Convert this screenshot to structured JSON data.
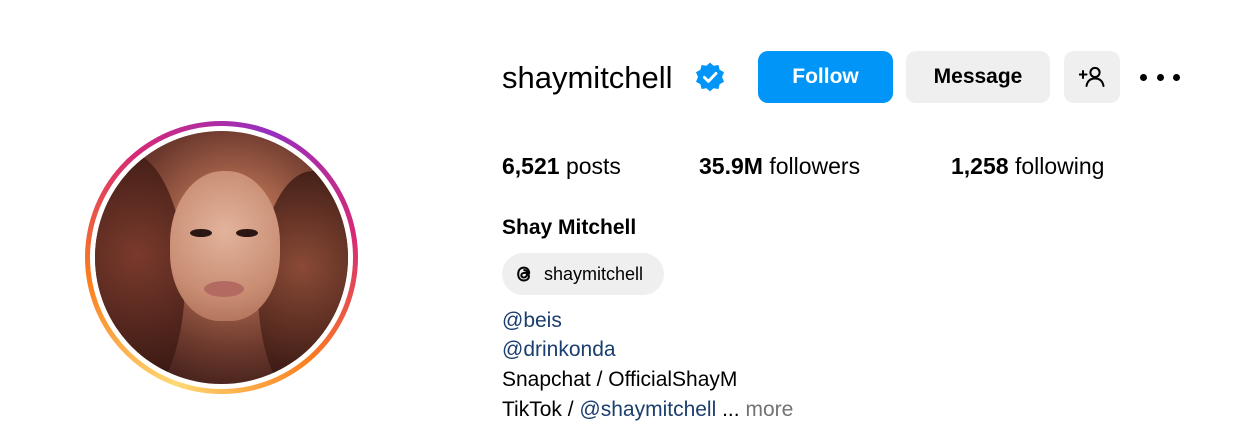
{
  "profile": {
    "username": "shaymitchell",
    "verified": true,
    "full_name": "Shay Mitchell",
    "avatar": "profile-photo"
  },
  "actions": {
    "follow_label": "Follow",
    "message_label": "Message",
    "add_user_icon": "person-add-icon",
    "more_icon": "more-options-icon"
  },
  "stats": {
    "posts": {
      "value": "6,521",
      "label": "posts"
    },
    "followers": {
      "value": "35.9M",
      "label": "followers"
    },
    "following": {
      "value": "1,258",
      "label": "following"
    }
  },
  "threads": {
    "icon": "threads-icon",
    "label": "shaymitchell"
  },
  "bio": {
    "line1": "@beis",
    "line2": "@drinkonda",
    "line3": "Snapchat / OfficialShayM",
    "line4_prefix": "TikTok / ",
    "line4_link": "@shaymitchell",
    "line4_ellipsis": " ...",
    "more_label": "more"
  },
  "colors": {
    "primary_button": "#0095f6",
    "secondary_button": "#efefef",
    "link": "#1b3e6e",
    "muted": "#737373",
    "verified_badge": "#0095f6"
  }
}
